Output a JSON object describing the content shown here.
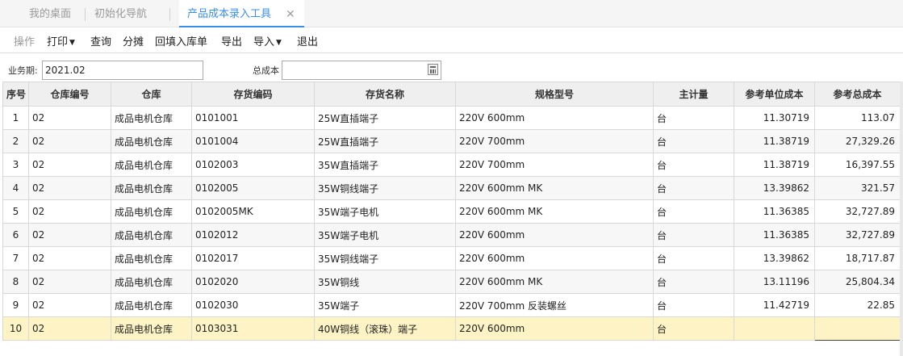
{
  "tabs": [
    {
      "label": "我的桌面"
    },
    {
      "label": "初始化导航"
    },
    {
      "label": "产品成本录入工具",
      "close": "✕"
    }
  ],
  "toolbar": {
    "operate": "操作",
    "print": "打印",
    "query": "查询",
    "allocate": "分摊",
    "backfill": "回填入库单",
    "export": "导出",
    "import": "导入",
    "exit": "退出"
  },
  "filters": {
    "period_label": "业务期:",
    "period_value": "2021.02",
    "total_cost_label": "总成本",
    "total_cost_value": ""
  },
  "columns": [
    "序号",
    "仓库编号",
    "仓库",
    "存货编码",
    "存货名称",
    "规格型号",
    "主计量",
    "参考单位成本",
    "参考总成本"
  ],
  "rows": [
    {
      "seq": "1",
      "wh_no": "02",
      "wh": "成品电机仓库",
      "code": "0101001",
      "name": "25W直插端子",
      "spec": "220V   600mm",
      "unit": "台",
      "unit_cost": "11.30719",
      "total": "113.07"
    },
    {
      "seq": "2",
      "wh_no": "02",
      "wh": "成品电机仓库",
      "code": "0101004",
      "name": "25W直插端子",
      "spec": "220V   700mm",
      "unit": "台",
      "unit_cost": "11.38719",
      "total": "27,329.26"
    },
    {
      "seq": "3",
      "wh_no": "02",
      "wh": "成品电机仓库",
      "code": "0102003",
      "name": "35W直插端子",
      "spec": "220V   700mm",
      "unit": "台",
      "unit_cost": "11.38719",
      "total": "16,397.55"
    },
    {
      "seq": "4",
      "wh_no": "02",
      "wh": "成品电机仓库",
      "code": "0102005",
      "name": "35W铜线端子",
      "spec": "220V   600mm  MK",
      "unit": "台",
      "unit_cost": "13.39862",
      "total": "321.57"
    },
    {
      "seq": "5",
      "wh_no": "02",
      "wh": "成品电机仓库",
      "code": "0102005MK",
      "name": "35W端子电机",
      "spec": "220V   600mm  MK",
      "unit": "台",
      "unit_cost": "11.36385",
      "total": "32,727.89"
    },
    {
      "seq": "6",
      "wh_no": "02",
      "wh": "成品电机仓库",
      "code": "0102012",
      "name": "35W端子电机",
      "spec": "220V   600mm",
      "unit": "台",
      "unit_cost": "11.36385",
      "total": "32,727.89"
    },
    {
      "seq": "7",
      "wh_no": "02",
      "wh": "成品电机仓库",
      "code": "0102017",
      "name": "35W铜线端子",
      "spec": "220V   600mm",
      "unit": "台",
      "unit_cost": "13.39862",
      "total": "18,717.87"
    },
    {
      "seq": "8",
      "wh_no": "02",
      "wh": "成品电机仓库",
      "code": "0102020",
      "name": "35W铜线",
      "spec": "220V   600mm  MK",
      "unit": "台",
      "unit_cost": "13.11196",
      "total": "25,804.34"
    },
    {
      "seq": "9",
      "wh_no": "02",
      "wh": "成品电机仓库",
      "code": "0102030",
      "name": "35W端子",
      "spec": "220V  700mm  反装螺丝",
      "unit": "台",
      "unit_cost": "11.42719",
      "total": "22.85"
    },
    {
      "seq": "10",
      "wh_no": "02",
      "wh": "成品电机仓库",
      "code": "0103031",
      "name": "40W铜线（滚珠）端子",
      "spec": "220V  600mm",
      "unit": "台",
      "unit_cost": "",
      "total": ""
    }
  ],
  "colors": {
    "accent": "#3a8ee6",
    "selected_row": "#fdf3c4",
    "header_bg": "#efefef"
  }
}
